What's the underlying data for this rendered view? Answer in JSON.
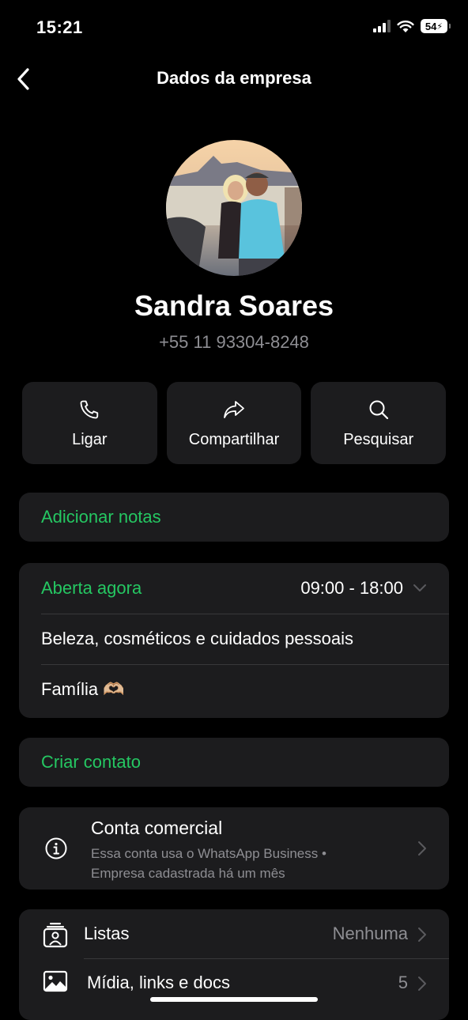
{
  "status_bar": {
    "time": "15:21",
    "battery": "54"
  },
  "nav": {
    "title": "Dados da empresa"
  },
  "profile": {
    "name": "Sandra Soares",
    "phone": "+55 11 93304-8248"
  },
  "actions": [
    {
      "label": "Ligar",
      "icon": "phone-icon"
    },
    {
      "label": "Compartilhar",
      "icon": "share-icon"
    },
    {
      "label": "Pesquisar",
      "icon": "search-icon"
    }
  ],
  "notes": {
    "label": "Adicionar notas"
  },
  "hours": {
    "status": "Aberta agora",
    "time": "09:00 - 18:00"
  },
  "category": "Beleza, cosméticos e cuidados pessoais",
  "description": "Família 🫶🏼",
  "create_contact": {
    "label": "Criar contato"
  },
  "business_account": {
    "title": "Conta comercial",
    "line1": "Essa conta usa o WhatsApp Business •",
    "line2": "Empresa cadastrada há um mês"
  },
  "list_items": [
    {
      "label": "Listas",
      "value": "Nenhuma",
      "icon": "lists-icon"
    },
    {
      "label": "Mídia, links e docs",
      "value": "5",
      "icon": "media-icon"
    }
  ],
  "colors": {
    "accent": "#25c762",
    "card": "#1c1c1e",
    "background": "#000000",
    "secondary_text": "#8e8e93"
  }
}
